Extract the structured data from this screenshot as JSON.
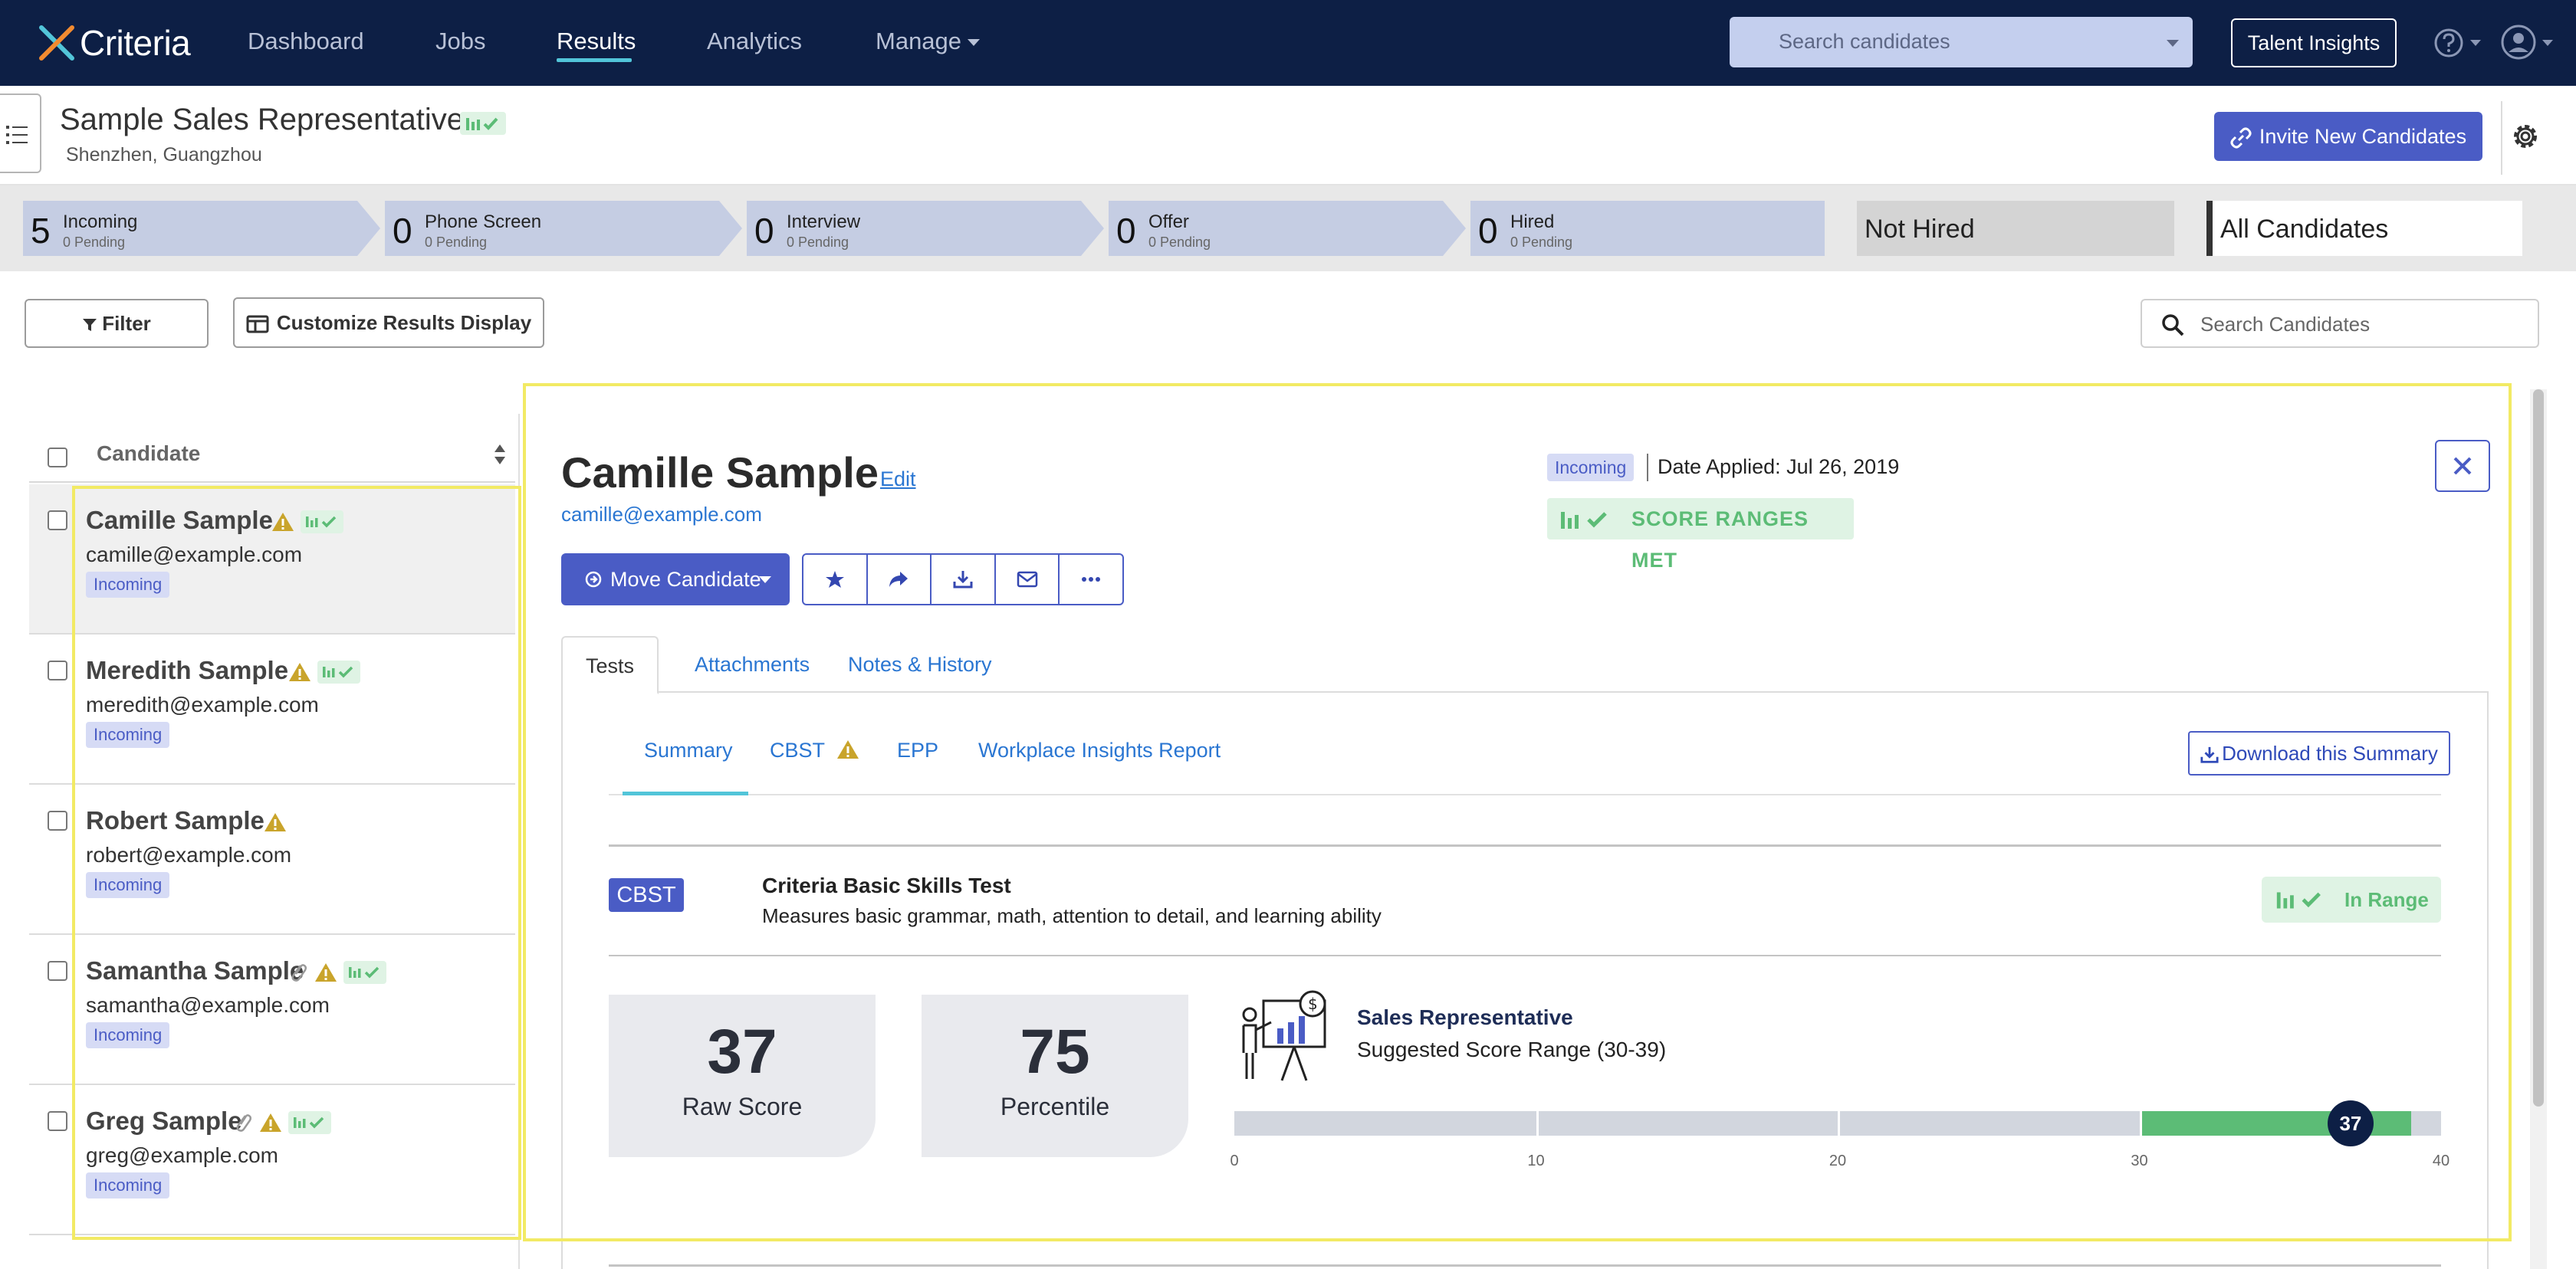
{
  "nav": {
    "logo": "Criteria",
    "links": [
      "Dashboard",
      "Jobs",
      "Results",
      "Analytics",
      "Manage"
    ],
    "active": "Results",
    "search_placeholder": "Search candidates",
    "talent_insights": "Talent Insights"
  },
  "header": {
    "title": "Sample Sales Representative",
    "location": "Shenzhen, Guangzhou",
    "invite": "Invite New Candidates"
  },
  "pipeline": [
    {
      "count": "5",
      "label": "Incoming",
      "pending": "0 Pending"
    },
    {
      "count": "0",
      "label": "Phone Screen",
      "pending": "0 Pending"
    },
    {
      "count": "0",
      "label": "Interview",
      "pending": "0 Pending"
    },
    {
      "count": "0",
      "label": "Offer",
      "pending": "0 Pending"
    },
    {
      "count": "0",
      "label": "Hired",
      "pending": "0 Pending"
    },
    {
      "label": "Not Hired"
    },
    {
      "label": "All Candidates"
    }
  ],
  "toolbar": {
    "filter": "Filter",
    "customize": "Customize Results Display",
    "search_placeholder": "Search Candidates"
  },
  "list": {
    "header": "Candidate",
    "candidates": [
      {
        "name": "Camille Sample",
        "email": "camille@example.com",
        "status": "Incoming"
      },
      {
        "name": "Meredith Sample",
        "email": "meredith@example.com",
        "status": "Incoming"
      },
      {
        "name": "Robert Sample",
        "email": "robert@example.com",
        "status": "Incoming"
      },
      {
        "name": "Samantha Sample",
        "email": "samantha@example.com",
        "status": "Incoming"
      },
      {
        "name": "Greg Sample",
        "email": "greg@example.com",
        "status": "Incoming"
      }
    ]
  },
  "detail": {
    "name": "Camille Sample",
    "edit": "Edit",
    "email": "camille@example.com",
    "status": "Incoming",
    "date_applied": "Date Applied: Jul 26, 2019",
    "score_ranges": "SCORE RANGES MET",
    "move": "Move Candidate",
    "tabs": [
      "Tests",
      "Attachments",
      "Notes & History"
    ],
    "subtabs": [
      "Summary",
      "CBST",
      "EPP",
      "Workplace Insights Report"
    ],
    "download": "Download this Summary",
    "test": {
      "tag": "CBST",
      "name": "Criteria Basic Skills Test",
      "desc": "Measures basic grammar, math, attention to detail, and learning ability",
      "in_range": "In Range",
      "raw_score": "37",
      "raw_label": "Raw Score",
      "percentile": "75",
      "percentile_label": "Percentile",
      "role": "Sales Representative",
      "suggested": "Suggested Score Range (30-39)",
      "scale": {
        "min": 0,
        "max": 40,
        "range_low": 30,
        "range_high": 39,
        "score": 37,
        "ticks": [
          "0",
          "10",
          "20",
          "30",
          "40"
        ]
      },
      "marker": "37"
    }
  },
  "colors": {
    "nav_bg": "#0d1f45",
    "accent": "#4a5cc5",
    "success": "#5cbc76",
    "link": "#2a76d2",
    "highlight": "#f2ea64"
  }
}
